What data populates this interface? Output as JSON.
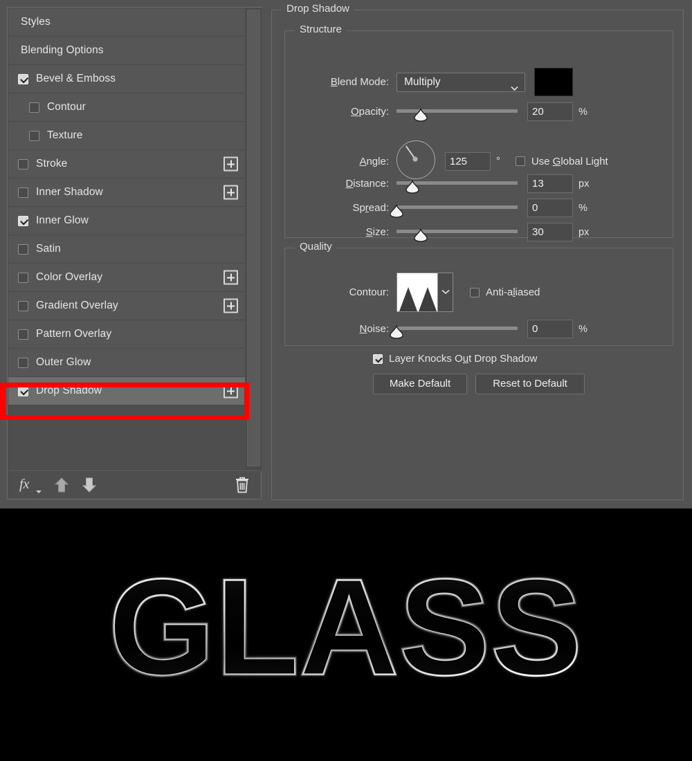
{
  "dialog": {
    "effects_list": [
      {
        "label": "Styles",
        "checkbox": "none",
        "indent": 0,
        "has_plus": false,
        "selected": false
      },
      {
        "label": "Blending Options",
        "checkbox": "none",
        "indent": 0,
        "has_plus": false,
        "selected": false
      },
      {
        "label": "Bevel & Emboss",
        "checkbox": "checked",
        "indent": 0,
        "has_plus": false,
        "selected": false
      },
      {
        "label": "Contour",
        "checkbox": "unchecked",
        "indent": 1,
        "has_plus": false,
        "selected": false
      },
      {
        "label": "Texture",
        "checkbox": "unchecked",
        "indent": 1,
        "has_plus": false,
        "selected": false
      },
      {
        "label": "Stroke",
        "checkbox": "unchecked",
        "indent": 0,
        "has_plus": true,
        "selected": false
      },
      {
        "label": "Inner Shadow",
        "checkbox": "unchecked",
        "indent": 0,
        "has_plus": true,
        "selected": false
      },
      {
        "label": "Inner Glow",
        "checkbox": "checked",
        "indent": 0,
        "has_plus": false,
        "selected": false
      },
      {
        "label": "Satin",
        "checkbox": "unchecked",
        "indent": 0,
        "has_plus": false,
        "selected": false
      },
      {
        "label": "Color Overlay",
        "checkbox": "unchecked",
        "indent": 0,
        "has_plus": true,
        "selected": false
      },
      {
        "label": "Gradient Overlay",
        "checkbox": "unchecked",
        "indent": 0,
        "has_plus": true,
        "selected": false
      },
      {
        "label": "Pattern Overlay",
        "checkbox": "unchecked",
        "indent": 0,
        "has_plus": false,
        "selected": false
      },
      {
        "label": "Outer Glow",
        "checkbox": "unchecked",
        "indent": 0,
        "has_plus": false,
        "selected": false
      },
      {
        "label": "Drop Shadow",
        "checkbox": "checked",
        "indent": 0,
        "has_plus": true,
        "selected": true
      }
    ],
    "list_toolbar": {
      "fx_label": "fx",
      "move_up_icon": "arrow-up-icon",
      "move_down_icon": "arrow-down-icon",
      "delete_icon": "trash-icon"
    },
    "highlight": {
      "target": "Drop Shadow",
      "color": "#ff0000"
    },
    "panel": {
      "title": "Drop Shadow",
      "structure": {
        "title": "Structure",
        "blend_mode": {
          "label": "Blend Mode:",
          "value": "Multiply",
          "color_swatch": "#000000"
        },
        "opacity": {
          "label": "Opacity:",
          "value": "20",
          "unit": "%",
          "slider_pct": 20
        },
        "angle": {
          "label": "Angle:",
          "value": "125",
          "unit": "°",
          "degrees": 125
        },
        "use_global_light": {
          "label": "Use Global Light",
          "checked": false
        },
        "distance": {
          "label": "Distance:",
          "value": "13",
          "unit": "px",
          "slider_pct": 13
        },
        "spread": {
          "label": "Spread:",
          "value": "0",
          "unit": "%",
          "slider_pct": 0
        },
        "size": {
          "label": "Size:",
          "value": "30",
          "unit": "px",
          "slider_pct": 20
        }
      },
      "quality": {
        "title": "Quality",
        "contour": {
          "label": "Contour:",
          "preset": "double-peak-contour"
        },
        "anti_aliased": {
          "label": "Anti-aliased",
          "checked": false
        },
        "noise": {
          "label": "Noise:",
          "value": "0",
          "unit": "%",
          "slider_pct": 0
        }
      },
      "layer_knocks_out": {
        "label": "Layer Knocks Out Drop Shadow",
        "checked": true
      },
      "make_default_label": "Make Default",
      "reset_default_label": "Reset to Default"
    }
  },
  "preview": {
    "text": "GLASS",
    "background": "#000000",
    "effect": "glass-bevel-emboss"
  }
}
